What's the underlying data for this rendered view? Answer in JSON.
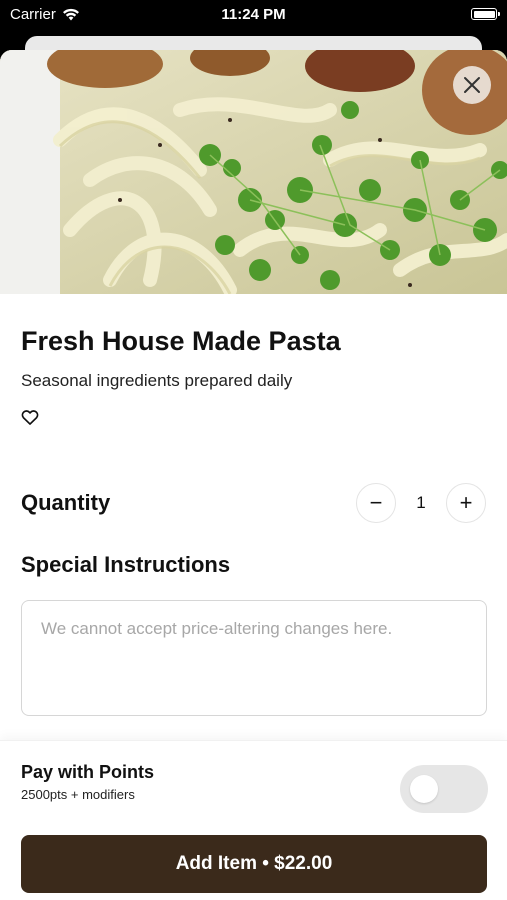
{
  "status_bar": {
    "carrier": "Carrier",
    "time": "11:24 PM",
    "icons": [
      "wifi-icon",
      "battery-icon"
    ]
  },
  "item": {
    "name": "Fresh House Made Pasta",
    "description": "Seasonal ingredients prepared daily",
    "image": "pasta-photo"
  },
  "quantity": {
    "label": "Quantity",
    "value": "1",
    "minus": "−",
    "plus": "+"
  },
  "special_instructions": {
    "label": "Special Instructions",
    "placeholder": "We cannot accept price-altering changes here.",
    "value": ""
  },
  "points": {
    "title": "Pay with Points",
    "subtitle": "2500pts + modifiers",
    "enabled": false
  },
  "add_button": {
    "label": "Add Item • $22.00"
  },
  "colors": {
    "add_button_bg": "#3b2a1b",
    "toggle_off": "#e6e6e6"
  }
}
